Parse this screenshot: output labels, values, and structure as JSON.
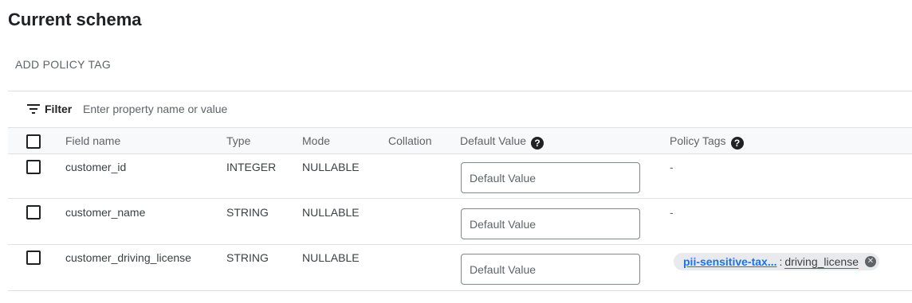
{
  "page": {
    "title": "Current schema",
    "add_policy_tag": "ADD POLICY TAG"
  },
  "filter": {
    "label": "Filter",
    "placeholder": "Enter property name or value",
    "icon": "filter-icon"
  },
  "table": {
    "headers": {
      "field_name": "Field name",
      "type": "Type",
      "mode": "Mode",
      "collation": "Collation",
      "default_value": "Default Value",
      "policy_tags": "Policy Tags"
    },
    "help_icon_glyph": "?",
    "rows": [
      {
        "field_name": "customer_id",
        "type": "INTEGER",
        "mode": "NULLABLE",
        "collation": "",
        "default_value": "",
        "default_placeholder": "Default Value",
        "policy_tag": "-"
      },
      {
        "field_name": "customer_name",
        "type": "STRING",
        "mode": "NULLABLE",
        "collation": "",
        "default_value": "",
        "default_placeholder": "Default Value",
        "policy_tag": "-"
      },
      {
        "field_name": "customer_driving_license",
        "type": "STRING",
        "mode": "NULLABLE",
        "collation": "",
        "default_value": "",
        "default_placeholder": "Default Value",
        "policy_chip": {
          "taxonomy": "pii-sensitive-tax...",
          "separator": ":",
          "tag": "driving_license",
          "close_glyph": "✕"
        }
      }
    ]
  },
  "colors": {
    "link": "#1a73e8",
    "chip_bg": "#e8eaed",
    "header_bg": "#f8f9fa",
    "border": "#e0e0e0"
  }
}
